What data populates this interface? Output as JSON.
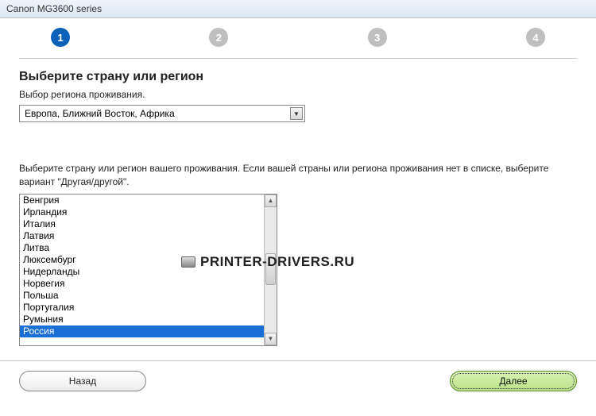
{
  "window": {
    "title": "Canon MG3600 series"
  },
  "steps": {
    "labels": [
      "1",
      "2",
      "3",
      "4"
    ],
    "active_index": 0
  },
  "heading": "Выберите страну или регион",
  "region_label": "Выбор региона проживания.",
  "region_select": {
    "selected": "Европа, Ближний Восток, Африка"
  },
  "instruction": "Выберите страну или регион вашего проживания. Если вашей страны или региона проживания нет в списке, выберите вариант \"Другая/другой\".",
  "countries": {
    "items": [
      "Венгрия",
      "Ирландия",
      "Италия",
      "Латвия",
      "Литва",
      "Люксембург",
      "Нидерланды",
      "Норвегия",
      "Польша",
      "Португалия",
      "Румыния",
      "Россия"
    ],
    "selected_index": 11
  },
  "watermark": {
    "text": "PRINTER-DRIVERS.RU"
  },
  "buttons": {
    "back": "Назад",
    "next": "Далее"
  }
}
